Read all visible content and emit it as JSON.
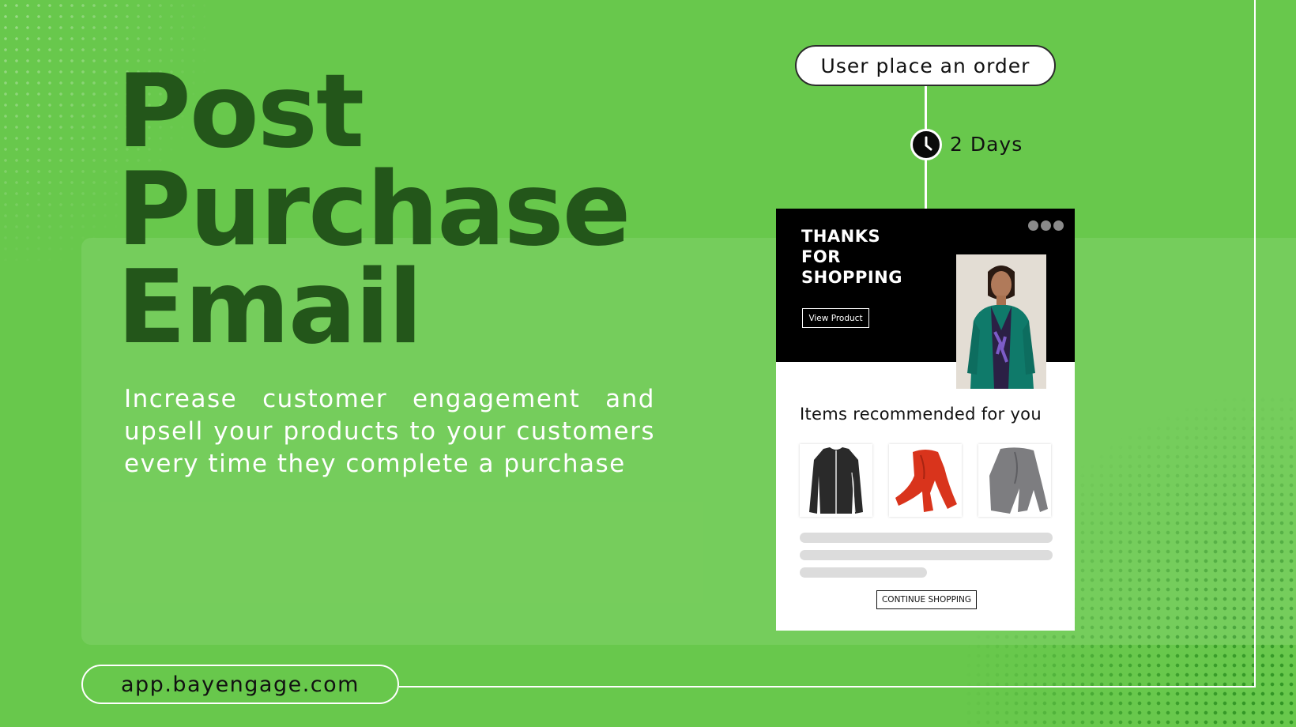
{
  "headline": {
    "line1": "Post",
    "line2": "Purchase",
    "line3": "Email"
  },
  "subtext": "Increase customer engagement and upsell your products to your customers every time they complete a purchase",
  "url": "app.bayengage.com",
  "flow": {
    "trigger_label": "User place an order",
    "delay_label": "2 Days"
  },
  "email": {
    "heading": "THANKS FOR SHOPPING",
    "view_button": "View Product",
    "recommend_title": "Items recommended for you",
    "products": [
      {
        "name": "black-cardigan"
      },
      {
        "name": "red-scarf"
      },
      {
        "name": "grey-scarf"
      }
    ],
    "continue_button": "CONTINUE SHOPPING"
  },
  "colors": {
    "background": "#68c84c",
    "headline": "#23561a",
    "email_header": "#000000"
  }
}
